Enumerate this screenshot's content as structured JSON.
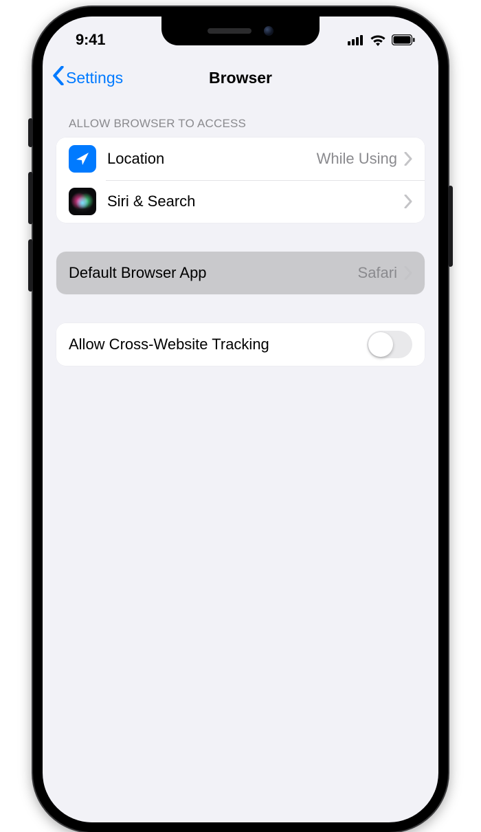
{
  "status": {
    "time": "9:41"
  },
  "nav": {
    "back_label": "Settings",
    "title": "Browser"
  },
  "sections": {
    "access_header": "ALLOW BROWSER TO ACCESS"
  },
  "rows": {
    "location": {
      "label": "Location",
      "value": "While Using",
      "icon": "location-arrow-icon"
    },
    "siri": {
      "label": "Siri & Search",
      "icon": "siri-icon"
    },
    "default_browser": {
      "label": "Default Browser App",
      "value": "Safari"
    },
    "tracking": {
      "label": "Allow Cross-Website Tracking",
      "state": "off"
    }
  },
  "colors": {
    "tint": "#007aff",
    "background": "#f2f2f7",
    "cell": "#ffffff",
    "highlighted_cell": "#c9c9cc",
    "secondary_label": "#8a8a8e"
  }
}
